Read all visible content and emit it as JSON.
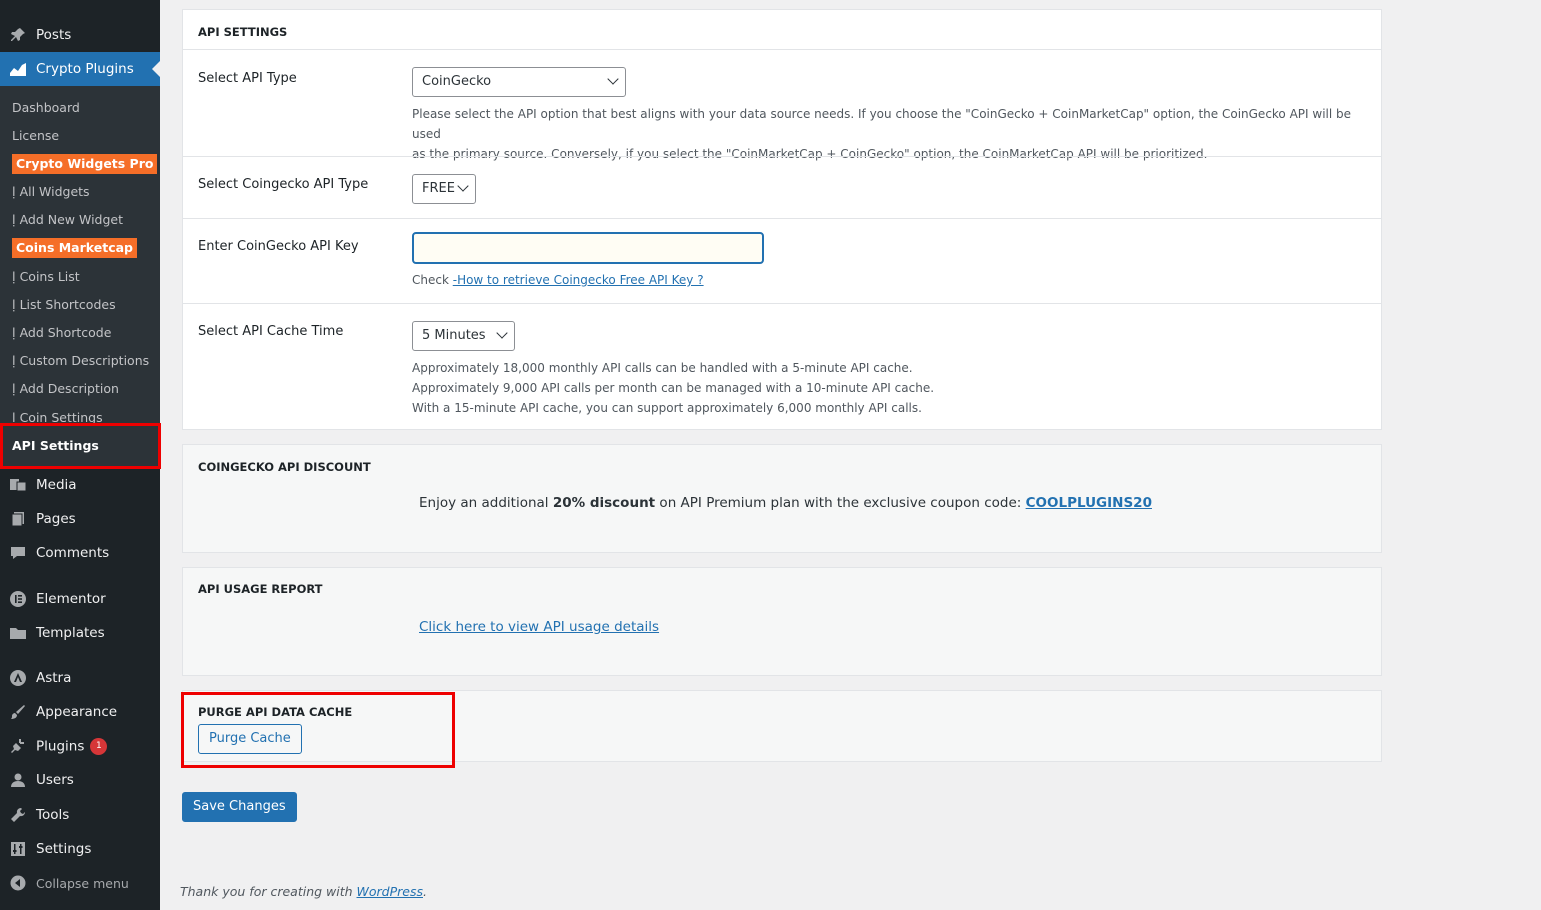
{
  "sidebar": {
    "posts": "Posts",
    "crypto_plugins": "Crypto Plugins",
    "sub": {
      "dashboard": "Dashboard",
      "license": "License",
      "crypto_widgets_pro": "Crypto Widgets Pro",
      "all_widgets": "ḷ All Widgets",
      "add_new_widget": "ḷ Add New Widget",
      "coins_marketcap": "Coins Marketcap",
      "coins_list": "ḷ Coins List",
      "list_shortcodes": "ḷ List Shortcodes",
      "add_shortcode": "ḷ Add Shortcode",
      "custom_descriptions": "ḷ Custom Descriptions",
      "add_description": "ḷ Add Description",
      "coin_settings": "ḷ Coin Settings",
      "api_settings": "API Settings"
    },
    "media": "Media",
    "pages": "Pages",
    "comments": "Comments",
    "elementor": "Elementor",
    "templates": "Templates",
    "astra": "Astra",
    "appearance": "Appearance",
    "plugins": "Plugins",
    "plugins_count": "1",
    "users": "Users",
    "tools": "Tools",
    "settings": "Settings",
    "collapse": "Collapse menu"
  },
  "api_settings": {
    "title": "API SETTINGS",
    "api_type_label": "Select API Type",
    "api_type_value": "CoinGecko",
    "api_type_desc_1": "Please select the API option that best aligns with your data source needs. If you choose the \"CoinGecko + CoinMarketCap\" option, the CoinGecko API will be used",
    "api_type_desc_2": "as the primary source. Conversely, if you select the \"CoinMarketCap + CoinGecko\" option, the CoinMarketCap API will be prioritized.",
    "cg_type_label": "Select Coingecko API Type",
    "cg_type_value": "FREE",
    "key_label": "Enter CoinGecko API Key",
    "key_value": "",
    "key_help_prefix": "Check ",
    "key_help_link": "-How to retrieve Coingecko Free API Key ?",
    "cache_label": "Select API Cache Time",
    "cache_value": "5 Minutes",
    "cache_desc_1": "Approximately 18,000 monthly API calls can be handled with a 5-minute API cache.",
    "cache_desc_2": "Approximately 9,000 API calls per month can be managed with a 10-minute API cache.",
    "cache_desc_3": "With a 15-minute API cache, you can support approximately 6,000 monthly API calls."
  },
  "discount": {
    "title": "COINGECKO API DISCOUNT",
    "text_1": "Enjoy an additional ",
    "text_bold": "20% discount",
    "text_2": " on API Premium plan with the exclusive coupon code: ",
    "code": "COOLPLUGINS20"
  },
  "usage": {
    "title": "API USAGE REPORT",
    "link": "Click here to view API usage details"
  },
  "purge": {
    "title": "PURGE API DATA CACHE",
    "button": "Purge Cache"
  },
  "save_button": "Save Changes",
  "footer": {
    "prefix": "Thank you for creating with ",
    "link": "WordPress",
    "suffix": "."
  }
}
